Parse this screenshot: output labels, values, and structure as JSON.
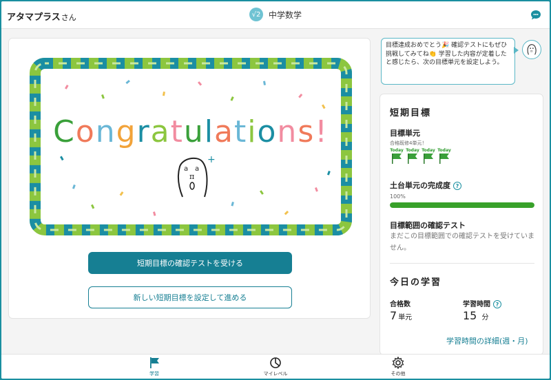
{
  "header": {
    "app_name": "アタマプラス",
    "app_suffix": "さん",
    "subject_icon_text": "√2",
    "subject_label": "中学数学",
    "chat_icon": "chat-bubble-icon"
  },
  "main": {
    "banner_text": "Congratulations!",
    "mascot_text": "a a π 0 +",
    "primary_button": "短期目標の確認テストを受ける",
    "secondary_button": "新しい短期目標を設定して進める"
  },
  "bubble": {
    "text": "目標達成おめでとう🎉 確認テストにもぜひ挑戦してみてね👏 学習した内容が定着したと感じたら、次の目標単元を設定しよう。"
  },
  "short_term": {
    "title": "短期目標",
    "target_units_label": "目標単元",
    "passed_note": "合格既修4単元！",
    "today_label": "Today",
    "flags_count": 4,
    "foundation_label": "土台単元の完成度",
    "progress_percent_label": "100%",
    "progress_value": 100,
    "test_label": "目標範囲の確認テスト",
    "test_status": "まだこの目標範囲での確認テストを受けていません。"
  },
  "today": {
    "title": "今日の学習",
    "passed_label": "合格数",
    "passed_value": "7",
    "passed_unit": "単元",
    "time_label": "学習時間",
    "time_value": "15",
    "time_unit": "分",
    "detail_link": "学習時間の詳細(週・月)"
  },
  "nav": {
    "learn": "学習",
    "mylevel": "マイレベル",
    "other": "その他"
  },
  "colors": {
    "accent": "#167f93",
    "progress": "#38a12a",
    "frame": "#1a8fa0"
  }
}
